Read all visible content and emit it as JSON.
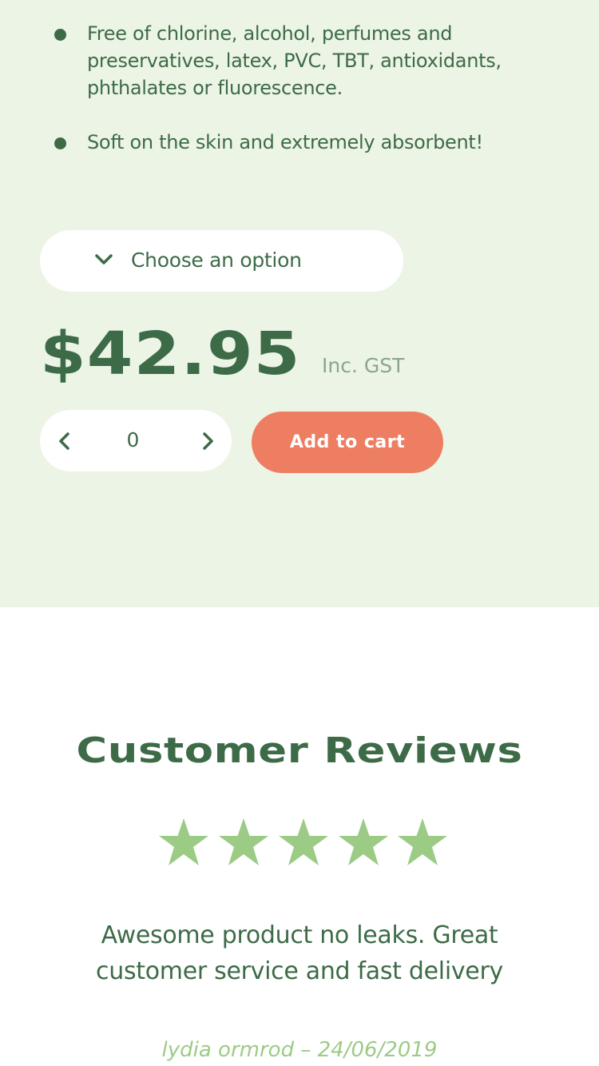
{
  "features": [
    "Free of chlorine, alcohol, perfumes and preservatives, latex, PVC, TBT, antioxidants, phthalates or fluorescence.",
    "Soft on the skin and extremely absorbent!"
  ],
  "option_select": {
    "label": "Choose an option",
    "icon": "chevron-down-icon"
  },
  "price": {
    "amount": "$42.95",
    "suffix": "Inc. GST"
  },
  "quantity": {
    "value": "0"
  },
  "cart": {
    "button_label": "Add to cart"
  },
  "reviews": {
    "title": "Customer Reviews",
    "rating": 5,
    "rating_max": 5,
    "text": "Awesome product no leaks. Great customer service and fast delivery",
    "author_line": "lydia ormrod – 24/06/2019"
  },
  "colors": {
    "brand_green": "#3d6b47",
    "light_green_bg": "#ecf4e6",
    "star_green": "#9ccb86",
    "accent_orange": "#ee7e61"
  }
}
